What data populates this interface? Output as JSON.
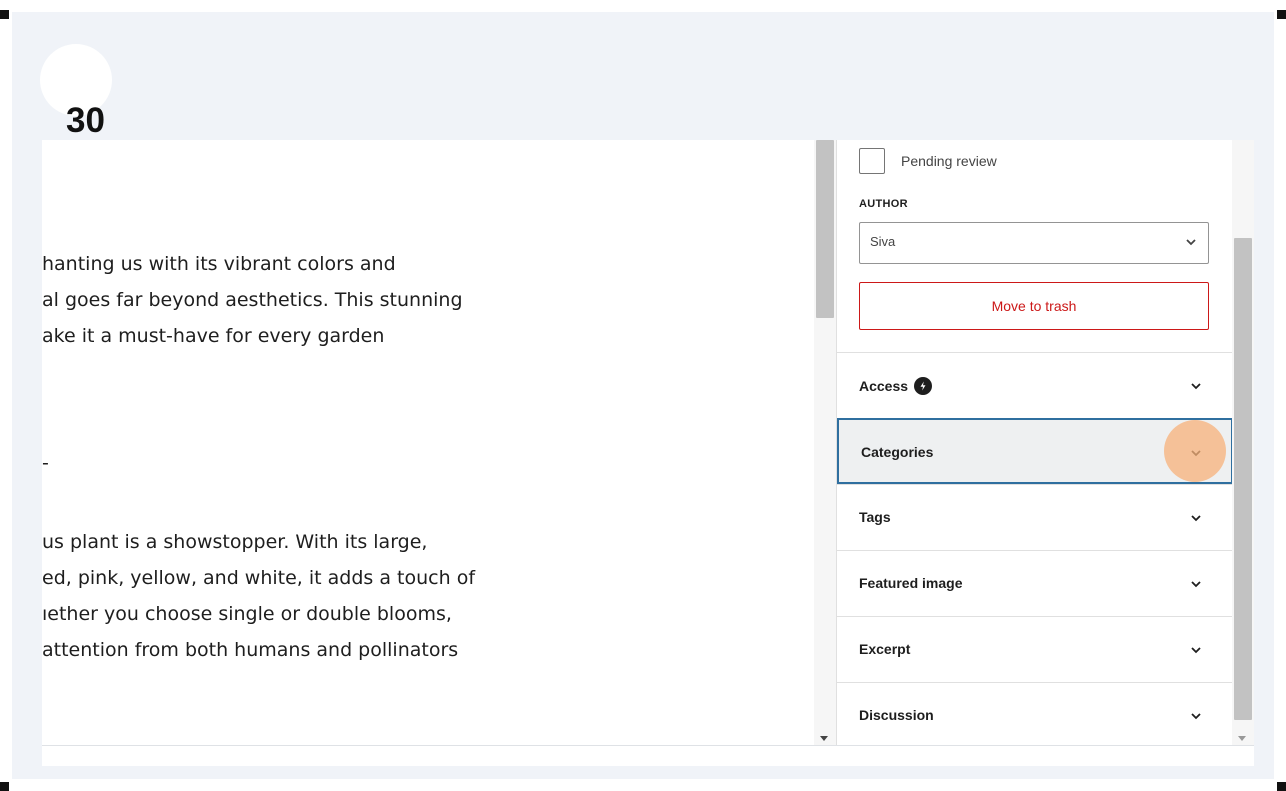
{
  "step": {
    "number": "30"
  },
  "editor": {
    "lines_group1": [
      "hanting us with its vibrant colors and",
      "al goes far beyond aesthetics. This stunning",
      "ake it a must-have for every garden"
    ],
    "dash": "-",
    "lines_group2": [
      "us plant is a showstopper. With its large,",
      "ed, pink, yellow, and white, it adds a touch of",
      "ıether you choose single or double blooms,",
      " attention from both humans and pollinators"
    ]
  },
  "sidebar": {
    "pending_review_label": "Pending review",
    "author_label": "AUTHOR",
    "author_value": "Siva",
    "move_to_trash_label": "Move to trash",
    "panels": [
      {
        "label": "Access"
      },
      {
        "label": "Categories"
      },
      {
        "label": "Tags"
      },
      {
        "label": "Featured image"
      },
      {
        "label": "Excerpt"
      },
      {
        "label": "Discussion"
      }
    ]
  },
  "colors": {
    "trash": "#cc1818",
    "focus_border": "#2f6f9f",
    "highlight": "#f7b17a"
  },
  "icons": {
    "access": "access-badge-icon",
    "chevron": "chevron-down-icon"
  }
}
